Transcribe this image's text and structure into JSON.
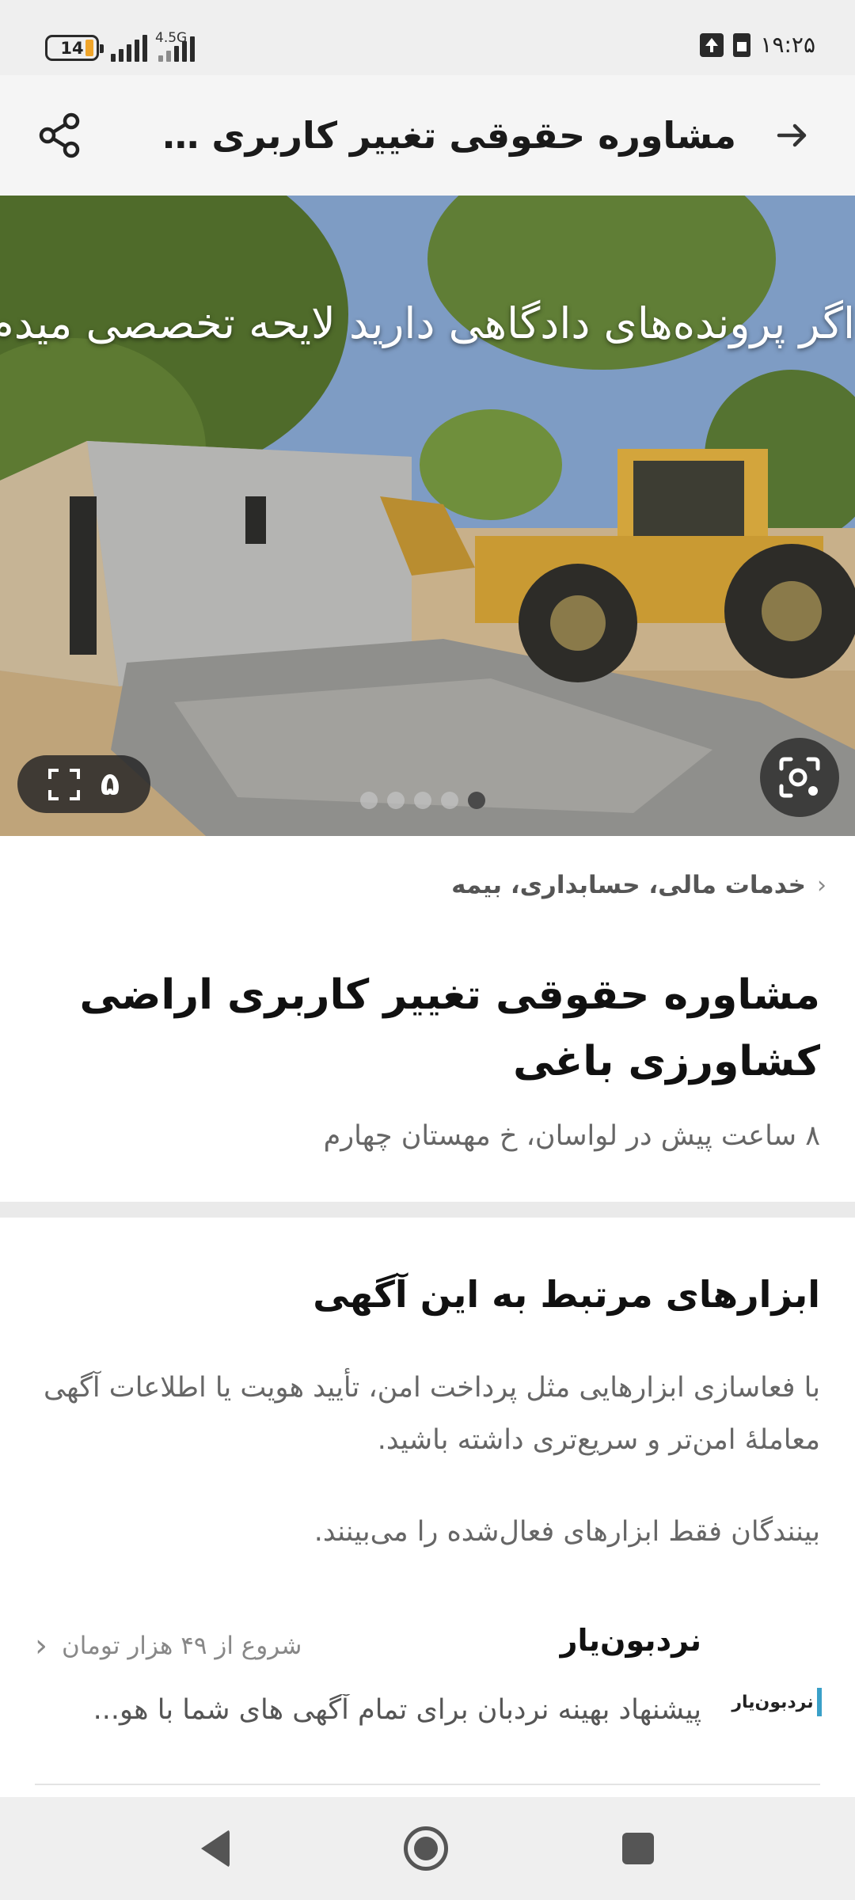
{
  "status_bar": {
    "battery": "14",
    "network": "4.5G",
    "time": "۱۹:۲۵"
  },
  "header": {
    "title": "مشاوره حقوقی تغییر کاربری اراضی کشاورزی باغی",
    "back_icon": "arrow-right-icon",
    "share_icon": "share-icon"
  },
  "gallery": {
    "caption": "اگر پرونده‌های دادگاهی دارید لایحه تخصصی میدم",
    "photo_count": "۵",
    "dots_total": 5,
    "active_dot": 5
  },
  "breadcrumb": {
    "category": "خدمات مالی، حسابداری، بیمه"
  },
  "post": {
    "title": "مشاوره حقوقی تغییر کاربری اراضی کشاورزی باغی",
    "meta": "۸ ساعت پیش در لواسان، خ مهستان چهارم"
  },
  "tools": {
    "heading": "ابزارهای مرتبط به این آگهی",
    "description": "با فعاسازی ابزارهایی مثل پرداخت امن، تأیید هویت یا اطلاعات آگهی معاملهٔ امن‌تر و سریع‌تری داشته باشید.",
    "note": "بینندگان فقط ابزارهای فعال‌شده را می‌بینند.",
    "items": [
      {
        "name": "نردبون‌یار",
        "logo_text": "نردبون‌یار",
        "price": "شروع از ۴۹ هزار تومان",
        "description": "پیشنهاد بهینه نردبان برای تمام آگهی های شما با هو..."
      }
    ]
  },
  "colors": {
    "status_bg": "#efefef",
    "header_bg": "#f5f5f5",
    "divider": "#eaeaea",
    "battery_accent": "#f0a52a"
  }
}
